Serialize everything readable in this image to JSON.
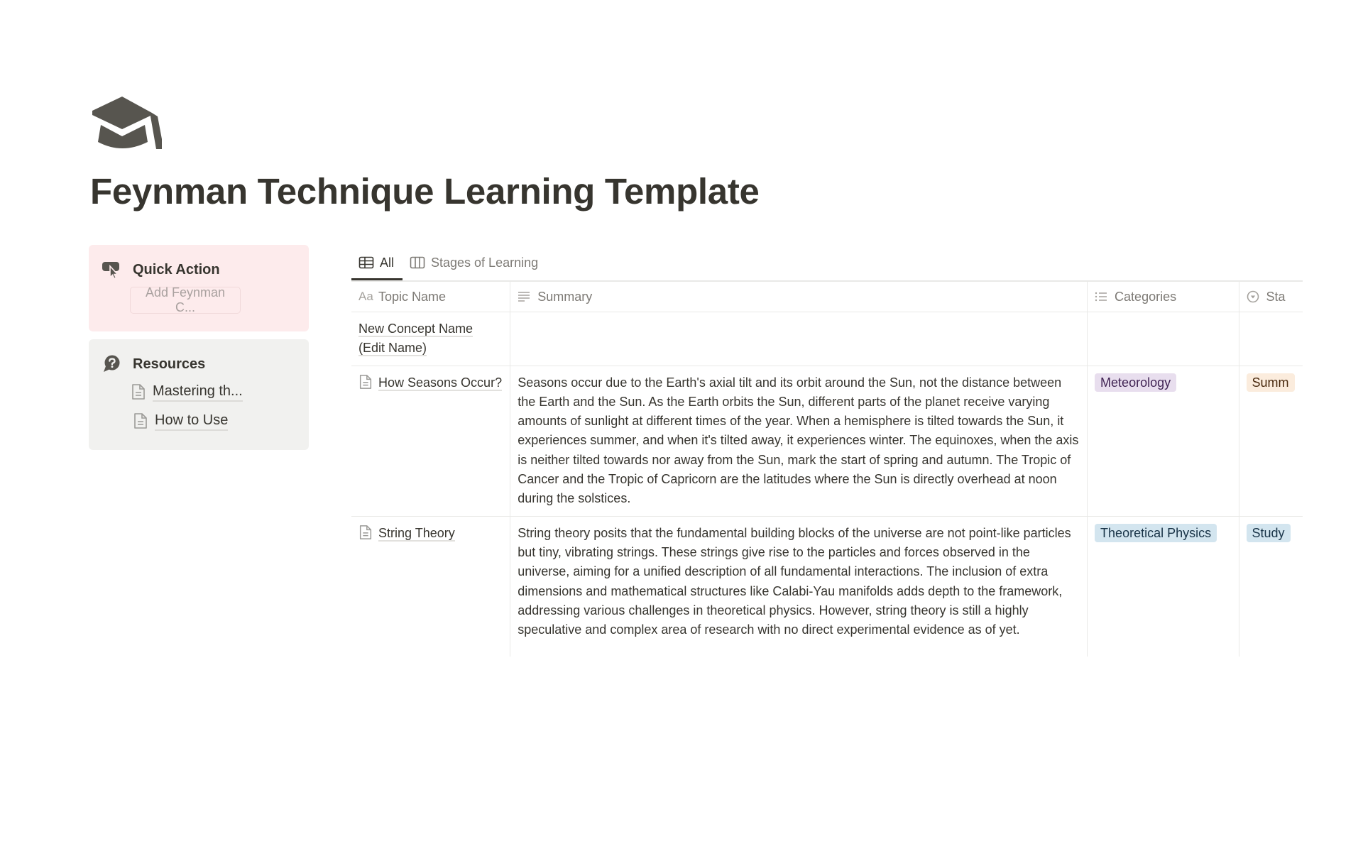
{
  "page": {
    "icon": "graduation-cap-icon",
    "title": "Feynman Technique Learning Template"
  },
  "quick_action": {
    "icon": "cursor-click-icon",
    "title": "Quick Action",
    "button_label": "Add Feynman C...",
    "background": "#fdebec"
  },
  "resources": {
    "icon": "question-bubble-icon",
    "title": "Resources",
    "background": "#f1f1ef",
    "links": [
      {
        "label": "Mastering th...",
        "icon": "page-icon"
      },
      {
        "label": "How to Use",
        "icon": "page-icon"
      }
    ]
  },
  "views": {
    "tabs": [
      {
        "label": "All",
        "icon": "table-icon",
        "active": true
      },
      {
        "label": "Stages of Learning",
        "icon": "board-icon",
        "active": false
      }
    ]
  },
  "table": {
    "columns": [
      {
        "label": "Topic Name",
        "icon": "Aa"
      },
      {
        "label": "Summary",
        "icon": "text-lines-icon"
      },
      {
        "label": "Categories",
        "icon": "multi-select-icon"
      },
      {
        "label": "Sta",
        "icon": "status-icon"
      }
    ],
    "rows": [
      {
        "name_line1": "New Concept Name",
        "name_line2": "(Edit Name)",
        "has_icon": false,
        "summary": "",
        "category": null,
        "stage": null
      },
      {
        "name": "How Seasons Occur?",
        "has_icon": true,
        "summary": "Seasons occur due to the Earth's axial tilt and its orbit around the Sun, not the distance between the Earth and the Sun. As the Earth orbits the Sun, different parts of the planet receive varying amounts of sunlight at different times of the year. When a hemisphere is tilted towards the Sun, it experiences summer, and when it's tilted away, it experiences winter. The equinoxes, when the axis is neither tilted towards nor away from the Sun, mark the start of spring and autumn. The Tropic of Cancer and the Tropic of Capricorn are the latitudes where the Sun is directly overhead at noon during the solstices.",
        "category": {
          "label": "Meteorology",
          "bg": "#e8deee",
          "fg": "#412454"
        },
        "stage": {
          "label": "Summ",
          "bg": "#fbecdd",
          "fg": "#49290e"
        }
      },
      {
        "name": "String Theory",
        "has_icon": true,
        "summary": "String theory posits that the fundamental building blocks of the universe are not point-like particles but tiny, vibrating strings. These strings give rise to the particles and forces observed in the universe, aiming for a unified description of all fundamental interactions. The inclusion of extra dimensions and mathematical structures like Calabi-Yau manifolds adds depth to the framework, addressing various challenges in theoretical physics. However, string theory is still a highly speculative and complex area of research with no direct experimental evidence as of yet.",
        "category": {
          "label": "Theoretical Physics",
          "bg": "#d3e5ef",
          "fg": "#183347"
        },
        "stage": {
          "label": "Study",
          "bg": "#d3e5ef",
          "fg": "#183347"
        }
      }
    ]
  }
}
